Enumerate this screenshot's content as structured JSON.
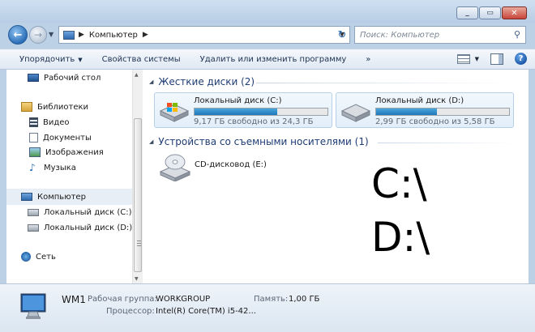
{
  "address": {
    "crumbs": [
      "Компьютер"
    ]
  },
  "search": {
    "placeholder": "Поиск: Компьютер"
  },
  "toolbar": {
    "organize": "Упорядочить",
    "system_properties": "Свойства системы",
    "uninstall": "Удалить или изменить программу",
    "more": "»"
  },
  "nav": {
    "desktop": "Рабочий стол",
    "libraries": "Библиотеки",
    "video": "Видео",
    "documents": "Документы",
    "images": "Изображения",
    "music": "Музыка",
    "computer": "Компьютер",
    "disk_c": "Локальный диск (C:)",
    "disk_d": "Локальный диск (D:)",
    "network": "Сеть"
  },
  "groups": {
    "hard_drives": "Жесткие диски (2)",
    "removable": "Устройства со съемными носителями (1)"
  },
  "drives": [
    {
      "name": "Локальный диск (C:)",
      "free_text": "9,17 ГБ свободно из 24,3 ГБ",
      "used_fraction": 0.62
    },
    {
      "name": "Локальный диск (D:)",
      "free_text": "2,99 ГБ свободно из 5,58 ГБ",
      "used_fraction": 0.46
    }
  ],
  "cd": {
    "name": "CD-дисковод (E:)"
  },
  "overlay": {
    "line1": "C:\\",
    "line2": "D:\\"
  },
  "details": {
    "computer_name": "WM1",
    "workgroup_label": "Рабочая группа:",
    "workgroup_value": "WORKGROUP",
    "memory_label": "Память:",
    "memory_value": "1,00 ГБ",
    "processor_label": "Процессор:",
    "processor_value": "Intel(R) Core(TM) i5-42..."
  }
}
